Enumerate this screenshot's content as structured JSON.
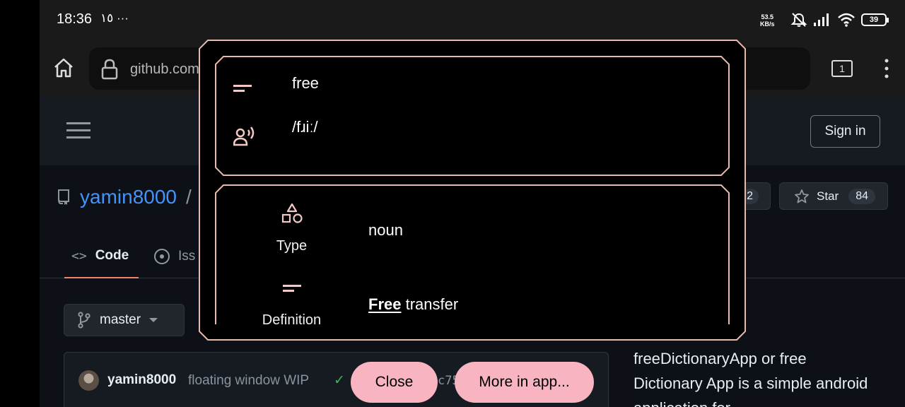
{
  "status_bar": {
    "time": "18:36",
    "extra": "١٥ ···",
    "net_speed": "53.5",
    "net_unit": "KB/s",
    "battery": "39"
  },
  "browser": {
    "url": "github.com",
    "tab_count": "1"
  },
  "github": {
    "sign_in_label": "Sign in",
    "repo_owner": "yamin8000",
    "repo_separator": "/",
    "fork_count": "2",
    "star_label": "Star",
    "star_count": "84",
    "tabs": {
      "code_label": "Code",
      "code_icon": "<>",
      "issues_label": "Iss"
    },
    "branch_label": "master",
    "commit": {
      "author": "yamin8000",
      "message": "floating window WIP",
      "check": "✓",
      "hash": "c75"
    },
    "about_text": "freeDictionaryApp or free Dictionary App is a simple android application for"
  },
  "dictionary": {
    "word": "free",
    "phonetic": "/fɹiː/",
    "type_label": "Type",
    "type_value": "noun",
    "definition_label": "Definition",
    "definition_highlight": "Free",
    "definition_rest": " transfer",
    "close_label": "Close",
    "more_label": "More in app..."
  },
  "colors": {
    "accent_pink": "#f9b4c1",
    "frame_border": "#e8b9ad",
    "link_blue": "#4493f8",
    "tab_underline": "#f78166"
  }
}
